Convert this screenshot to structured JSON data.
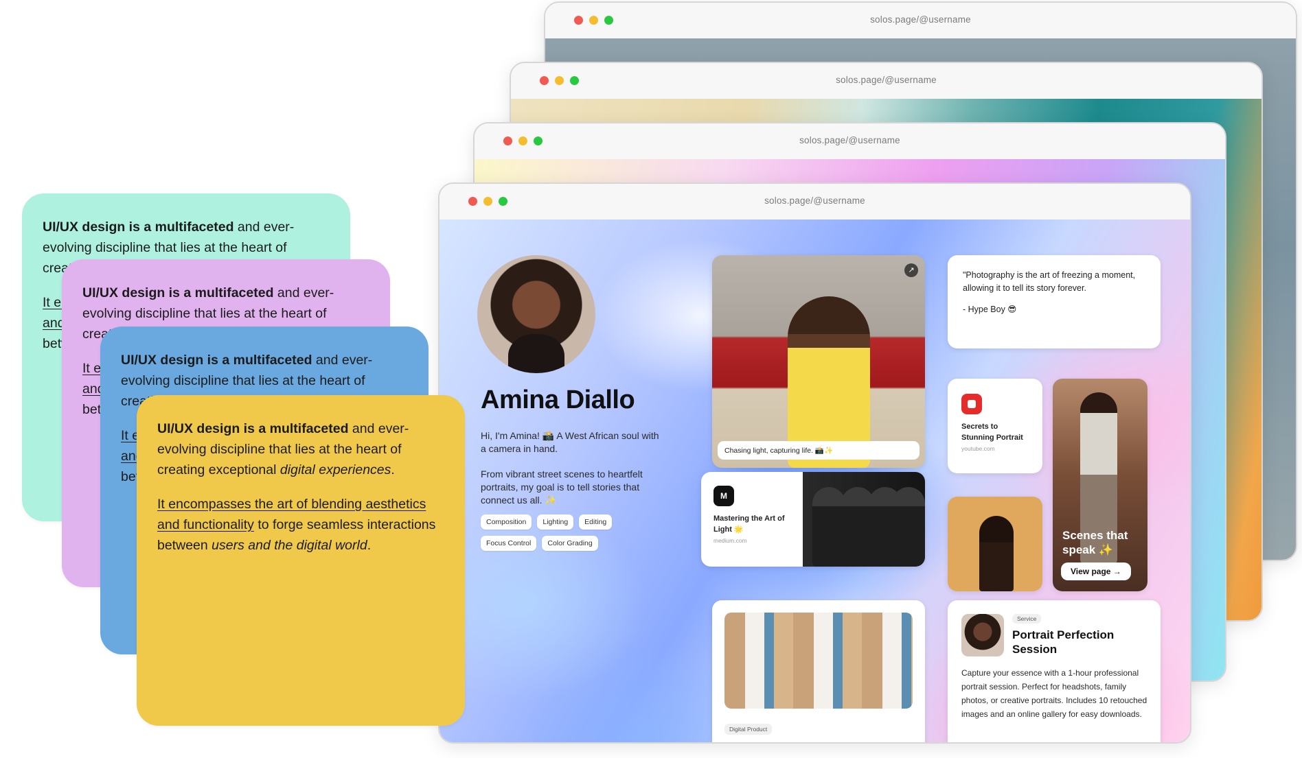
{
  "browser": {
    "url": "solos.page/@username"
  },
  "profile": {
    "name": "Amina Diallo",
    "intro": "Hi, I'm Amina! 📸 A West African soul with a camera in hand.",
    "bio": "From vibrant street scenes to heartfelt portraits, my goal is to tell stories that connect us all. ✨",
    "tags": [
      "Composition",
      "Lighting",
      "Editing",
      "Focus Control",
      "Color Grading"
    ]
  },
  "cards": {
    "photo_caption": "Chasing light, capturing life. 📸✨",
    "quote_text": "\"Photography is the art of freezing a moment, allowing it to tell its story forever.",
    "quote_attribution": "- Hype Boy 😎",
    "youtube_title": "Secrets to Stunning Portrait",
    "youtube_source": "youtube.com",
    "medium_logo": "M",
    "medium_title": "Mastering the Art of Light 🌟",
    "medium_source": "medium.com",
    "scenes_title": "Scenes that speak ✨",
    "scenes_button": "View page →",
    "digital_badge": "Digital Product",
    "service_badge": "Service",
    "service_title": "Portrait Perfection Session",
    "service_desc": "Capture your essence with a 1-hour professional portrait session. Perfect for headshots, family photos, or creative portraits. Includes 10 retouched images and an online gallery for easy downloads."
  },
  "notes": {
    "bold_lead": "UI/UX design is a multifaceted",
    "lead_rest_1": " and ever-evolving discipline that lies at the heart of creating exceptional ",
    "lead_italic": "digital experiences",
    "lead_end": ".",
    "underline_text": "It encompasses the art of blending aesthetics and functionality",
    "mid_text": " to forge seamless interactions between ",
    "end_italic": "users and the digital world",
    "end_dot": "."
  },
  "colors": {
    "note_mint": "#aef1df",
    "note_lilac": "#e0b3ee",
    "note_blue": "#69a9df",
    "note_yellow": "#f0c84a",
    "youtube_red": "#e62b2b"
  }
}
